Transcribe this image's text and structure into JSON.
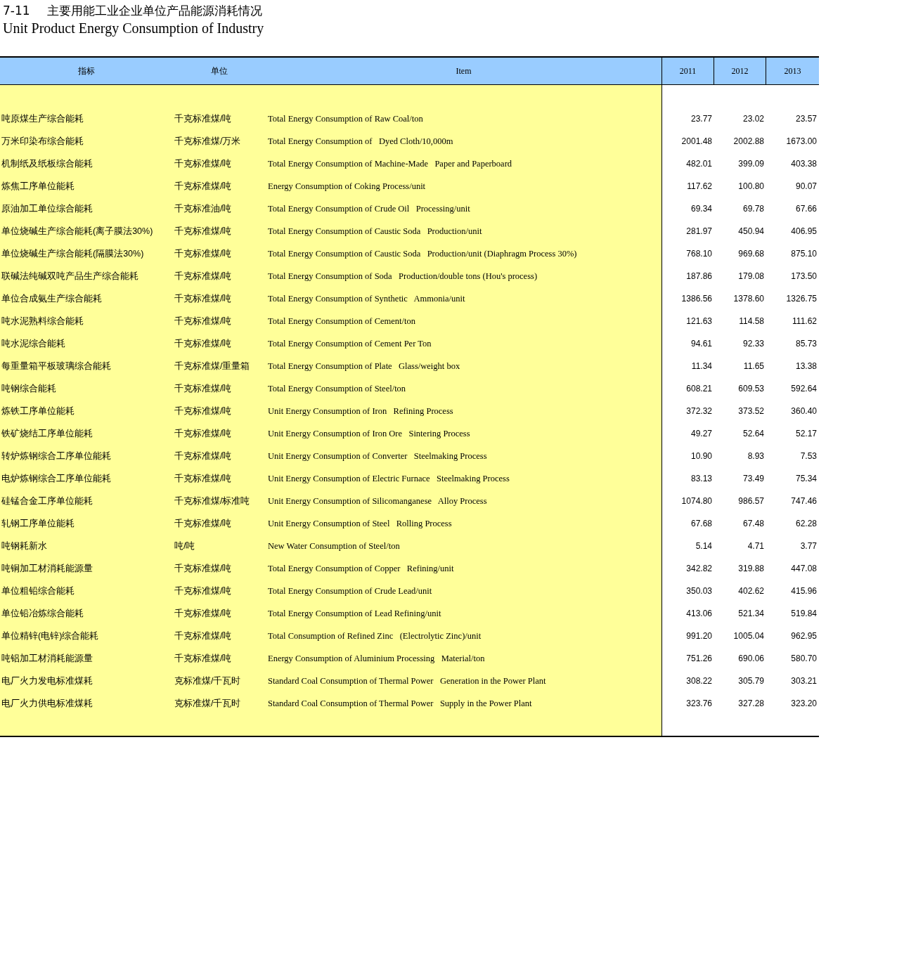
{
  "title": {
    "number": "7-11",
    "chinese": "主要用能工业企业单位产品能源消耗情况",
    "english": "Unit Product Energy Consumption of Industry"
  },
  "table": {
    "columns": [
      "指标",
      "单位",
      "Item",
      "2011",
      "2012",
      "2013"
    ],
    "rows": [
      {
        "indicator": "吨原煤生产综合能耗",
        "unit": "千克标准煤/吨",
        "item": "Total Energy Consumption of Raw Coal/ton",
        "values": [
          "23.77",
          "23.02",
          "23.57"
        ]
      },
      {
        "indicator": "万米印染布综合能耗",
        "unit": "千克标准煤/万米",
        "item": "Total Energy Consumption of   Dyed Cloth/10,000m",
        "values": [
          "2001.48",
          "2002.88",
          "1673.00"
        ]
      },
      {
        "indicator": "机制纸及纸板综合能耗",
        "unit": "千克标准煤/吨",
        "item": "Total Energy Consumption of Machine-Made   Paper and Paperboard",
        "values": [
          "482.01",
          "399.09",
          "403.38"
        ]
      },
      {
        "indicator": "炼焦工序单位能耗",
        "unit": "千克标准煤/吨",
        "item": "Energy Consumption of Coking Process/unit",
        "values": [
          "117.62",
          "100.80",
          "90.07"
        ]
      },
      {
        "indicator": "原油加工单位综合能耗",
        "unit": "千克标准油/吨",
        "item": "Total Energy Consumption of Crude Oil   Processing/unit",
        "values": [
          "69.34",
          "69.78",
          "67.66"
        ]
      },
      {
        "indicator": "单位烧碱生产综合能耗(离子膜法30%)",
        "unit": "千克标准煤/吨",
        "item": "Total Energy Consumption of Caustic Soda   Production/unit",
        "values": [
          "281.97",
          "450.94",
          "406.95"
        ]
      },
      {
        "indicator": "单位烧碱生产综合能耗(隔膜法30%)",
        "unit": "千克标准煤/吨",
        "item": "Total Energy Consumption of Caustic Soda   Production/unit (Diaphragm Process 30%)",
        "values": [
          "768.10",
          "969.68",
          "875.10"
        ]
      },
      {
        "indicator": "联碱法纯碱双吨产品生产综合能耗",
        "unit": "千克标准煤/吨",
        "item": "Total Energy Consumption of Soda   Production/double tons (Hou's process)",
        "values": [
          "187.86",
          "179.08",
          "173.50"
        ]
      },
      {
        "indicator": "单位合成氨生产综合能耗",
        "unit": "千克标准煤/吨",
        "item": "Total Energy Consumption of Synthetic   Ammonia/unit",
        "values": [
          "1386.56",
          "1378.60",
          "1326.75"
        ]
      },
      {
        "indicator": "吨水泥熟料综合能耗",
        "unit": "千克标准煤/吨",
        "item": "Total Energy Consumption of Cement/ton",
        "values": [
          "121.63",
          "114.58",
          "111.62"
        ]
      },
      {
        "indicator": "吨水泥综合能耗",
        "unit": "千克标准煤/吨",
        "item": "Total Energy Consumption of Cement Per Ton",
        "values": [
          "94.61",
          "92.33",
          "85.73"
        ]
      },
      {
        "indicator": "每重量箱平板玻璃综合能耗",
        "unit": "千克标准煤/重量箱",
        "item": "Total Energy Consumption of Plate   Glass/weight box",
        "values": [
          "11.34",
          "11.65",
          "13.38"
        ]
      },
      {
        "indicator": "吨钢综合能耗",
        "unit": "千克标准煤/吨",
        "item": "Total Energy Consumption of Steel/ton",
        "values": [
          "608.21",
          "609.53",
          "592.64"
        ]
      },
      {
        "indicator": "炼铁工序单位能耗",
        "unit": "千克标准煤/吨",
        "item": "Unit Energy Consumption of Iron   Refining Process",
        "values": [
          "372.32",
          "373.52",
          "360.40"
        ]
      },
      {
        "indicator": "铁矿烧结工序单位能耗",
        "unit": "千克标准煤/吨",
        "item": "Unit Energy Consumption of Iron Ore   Sintering Process",
        "values": [
          "49.27",
          "52.64",
          "52.17"
        ]
      },
      {
        "indicator": "转炉炼钢综合工序单位能耗",
        "unit": "千克标准煤/吨",
        "item": "Unit Energy Consumption of Converter   Steelmaking Process",
        "values": [
          "10.90",
          "8.93",
          "7.53"
        ]
      },
      {
        "indicator": "电炉炼钢综合工序单位能耗",
        "unit": "千克标准煤/吨",
        "item": "Unit Energy Consumption of Electric Furnace   Steelmaking Process",
        "values": [
          "83.13",
          "73.49",
          "75.34"
        ]
      },
      {
        "indicator": "硅锰合金工序单位能耗",
        "unit": "千克标准煤/标准吨",
        "item": "Unit Energy Consumption of Silicomanganese   Alloy Process",
        "values": [
          "1074.80",
          "986.57",
          "747.46"
        ]
      },
      {
        "indicator": "轧钢工序单位能耗",
        "unit": "千克标准煤/吨",
        "item": "Unit Energy Consumption of Steel   Rolling Process",
        "values": [
          "67.68",
          "67.48",
          "62.28"
        ]
      },
      {
        "indicator": "吨钢耗新水",
        "unit": "吨/吨",
        "item": "New Water Consumption of Steel/ton",
        "values": [
          "5.14",
          "4.71",
          "3.77"
        ]
      },
      {
        "indicator": "吨铜加工材消耗能源量",
        "unit": "千克标准煤/吨",
        "item": "Total Energy Consumption of Copper   Refining/unit",
        "values": [
          "342.82",
          "319.88",
          "447.08"
        ]
      },
      {
        "indicator": "单位粗铅综合能耗",
        "unit": "千克标准煤/吨",
        "item": "Total Energy Consumption of Crude Lead/unit",
        "values": [
          "350.03",
          "402.62",
          "415.96"
        ]
      },
      {
        "indicator": "单位铅冶炼综合能耗",
        "unit": "千克标准煤/吨",
        "item": "Total Energy Consumption of Lead Refining/unit",
        "values": [
          "413.06",
          "521.34",
          "519.84"
        ]
      },
      {
        "indicator": "单位精锌(电锌)综合能耗",
        "unit": "千克标准煤/吨",
        "item": "Total Consumption of Refined Zinc   (Electrolytic Zinc)/unit",
        "values": [
          "991.20",
          "1005.04",
          "962.95"
        ]
      },
      {
        "indicator": "吨铝加工材消耗能源量",
        "unit": "千克标准煤/吨",
        "item": "Energy Consumption of Aluminium Processing   Material/ton",
        "values": [
          "751.26",
          "690.06",
          "580.70"
        ]
      },
      {
        "indicator": "电厂火力发电标准煤耗",
        "unit": "克标准煤/千瓦时",
        "item": "Standard Coal Consumption of Thermal Power   Generation in the Power Plant",
        "values": [
          "308.22",
          "305.79",
          "303.21"
        ]
      },
      {
        "indicator": "电厂火力供电标准煤耗",
        "unit": "克标准煤/千瓦时",
        "item": "Standard Coal Consumption of Thermal Power   Supply in the Power Plant",
        "values": [
          "323.76",
          "327.28",
          "323.20"
        ]
      }
    ]
  }
}
